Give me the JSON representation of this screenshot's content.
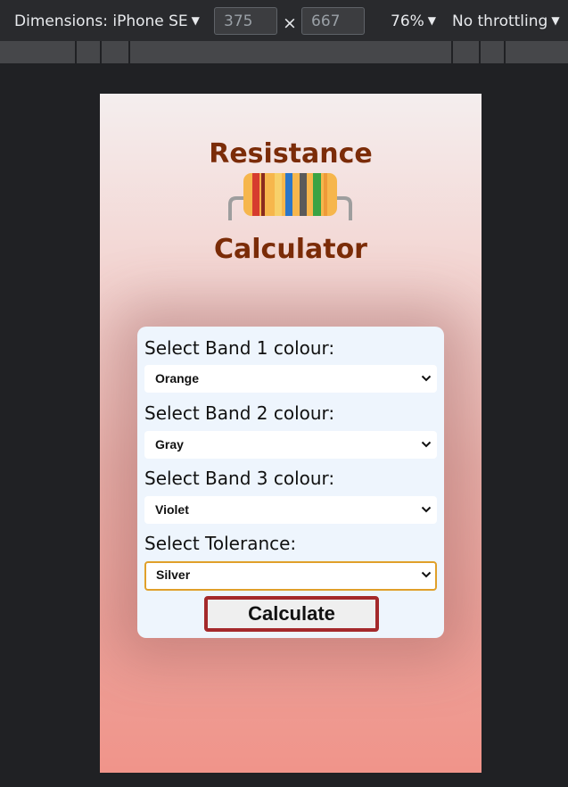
{
  "devtools": {
    "dimensions_label": "Dimensions: iPhone SE",
    "width_value": "375",
    "times_symbol": "×",
    "height_value": "667",
    "zoom": "76%",
    "throttling": "No throttling"
  },
  "app": {
    "title_line1": "Resistance",
    "title_line2": "Calculator",
    "band1_label": "Select Band 1 colour:",
    "band1_value": "Orange",
    "band2_label": "Select Band 2 colour:",
    "band2_value": "Gray",
    "band3_label": "Select Band 3 colour:",
    "band3_value": "Violet",
    "tolerance_label": "Select Tolerance:",
    "tolerance_value": "Silver",
    "calculate_label": "Calculate"
  },
  "colors": {
    "title": "#7b2c08",
    "card_bg": "#eef5fd",
    "button_border": "#a4292b",
    "focus_border": "#e0a02a",
    "gradient_top": "#f4eeee",
    "gradient_bottom": "#f0948a"
  },
  "icons": {
    "dropdown": "chevron-down-icon",
    "caret": "caret-down-icon",
    "logo": "resistor-icon"
  }
}
